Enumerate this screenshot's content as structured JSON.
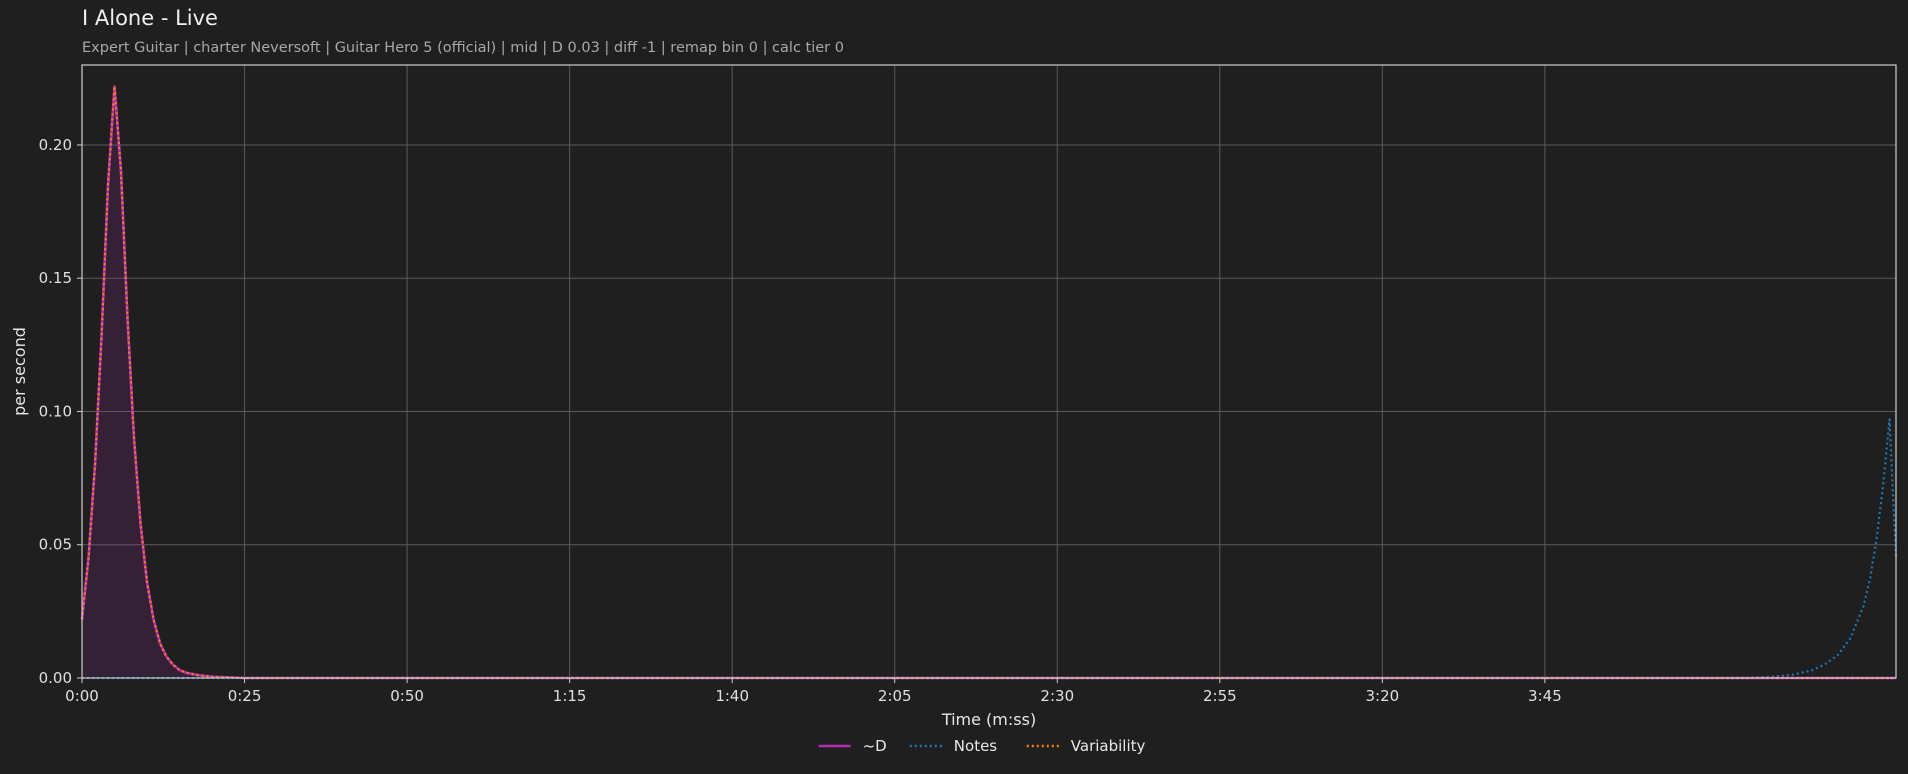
{
  "header": {
    "title": "I Alone - Live",
    "subtitle": "Expert Guitar  |  charter Neversoft  |  Guitar Hero 5 (official)  |  mid  |  D 0.03  |  diff -1  |  remap bin 0  |  calc tier 0"
  },
  "chart_data": {
    "type": "line",
    "title": "I Alone - Live",
    "xlabel": "Time (m:ss)",
    "ylabel": "per second",
    "xlim": [
      0,
      279
    ],
    "ylim": [
      0,
      0.23
    ],
    "x_ticks": [
      {
        "value": 0,
        "label": "0:00"
      },
      {
        "value": 25,
        "label": "0:25"
      },
      {
        "value": 50,
        "label": "0:50"
      },
      {
        "value": 75,
        "label": "1:15"
      },
      {
        "value": 100,
        "label": "1:40"
      },
      {
        "value": 125,
        "label": "2:05"
      },
      {
        "value": 150,
        "label": "2:30"
      },
      {
        "value": 175,
        "label": "2:55"
      },
      {
        "value": 200,
        "label": "3:20"
      },
      {
        "value": 225,
        "label": "3:45"
      }
    ],
    "y_ticks": [
      {
        "value": 0.0,
        "label": "0.00"
      },
      {
        "value": 0.05,
        "label": "0.05"
      },
      {
        "value": 0.1,
        "label": "0.10"
      },
      {
        "value": 0.15,
        "label": "0.15"
      },
      {
        "value": 0.2,
        "label": "0.20"
      }
    ],
    "grid": true,
    "legend_position": "bottom-center",
    "series": [
      {
        "name": "~D",
        "color": "#b32db3",
        "style": "solid",
        "fill": true,
        "x": [
          0,
          1,
          2,
          3,
          4,
          5,
          6,
          7,
          8,
          9,
          10,
          11,
          12,
          13,
          14,
          15,
          16,
          18,
          20,
          25,
          30,
          279
        ],
        "y": [
          0.022,
          0.045,
          0.08,
          0.128,
          0.185,
          0.222,
          0.19,
          0.135,
          0.09,
          0.058,
          0.036,
          0.022,
          0.013,
          0.008,
          0.005,
          0.003,
          0.002,
          0.001,
          0.0005,
          0.0,
          0.0,
          0.0
        ]
      },
      {
        "name": "Notes",
        "color": "#1f77b4",
        "style": "dotted",
        "fill": false,
        "x": [
          0,
          255,
          260,
          263,
          266,
          268,
          270,
          272,
          274,
          275,
          276,
          277,
          278,
          279
        ],
        "y": [
          0.0,
          0.0,
          0.0005,
          0.0012,
          0.0028,
          0.005,
          0.0085,
          0.015,
          0.027,
          0.037,
          0.052,
          0.072,
          0.097,
          0.045
        ]
      },
      {
        "name": "Variability",
        "color": "#ff7f0e",
        "style": "dotted",
        "fill": false,
        "x": [
          0,
          1,
          2,
          3,
          4,
          5,
          6,
          7,
          8,
          9,
          10,
          11,
          12,
          13,
          14,
          15,
          16,
          18,
          20,
          25,
          30,
          279
        ],
        "y": [
          0.022,
          0.045,
          0.08,
          0.128,
          0.185,
          0.222,
          0.19,
          0.135,
          0.09,
          0.058,
          0.036,
          0.022,
          0.013,
          0.008,
          0.005,
          0.003,
          0.002,
          0.001,
          0.0005,
          0.0,
          0.0,
          0.0
        ]
      }
    ]
  }
}
